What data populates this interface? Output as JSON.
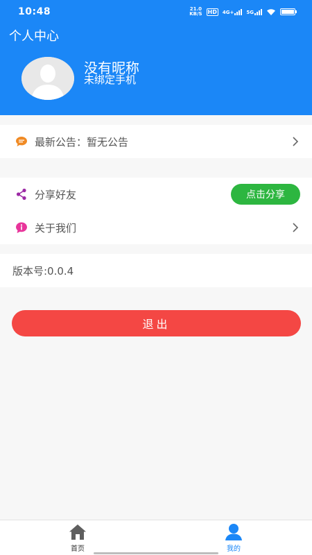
{
  "status_bar": {
    "time": "10:48",
    "net_speed_value": "21.0",
    "net_speed_unit": "KB/S",
    "hd_label": "HD",
    "net_4g": "4G+",
    "net_5g": "5G"
  },
  "header": {
    "title": "个人中心",
    "nickname": "没有昵称",
    "phone_status": "未绑定手机"
  },
  "notice": {
    "label": "最新公告：暂无公告"
  },
  "share": {
    "label": "分享好友",
    "button_label": "点击分享"
  },
  "about": {
    "label": "关于我们"
  },
  "version": {
    "label": "版本号:0.0.4"
  },
  "logout": {
    "label": "退出"
  },
  "bottom_nav": {
    "home_label": "首页",
    "mine_label": "我的"
  },
  "colors": {
    "header_bg": "#1b87f7",
    "share_button": "#2db640",
    "logout_button": "#f44744",
    "nav_active": "#1b87f7",
    "nav_inactive": "#5f5f5f",
    "notice_icon": "#f08a24",
    "share_icon": "#9c2aa5",
    "about_icon": "#e8359b"
  }
}
